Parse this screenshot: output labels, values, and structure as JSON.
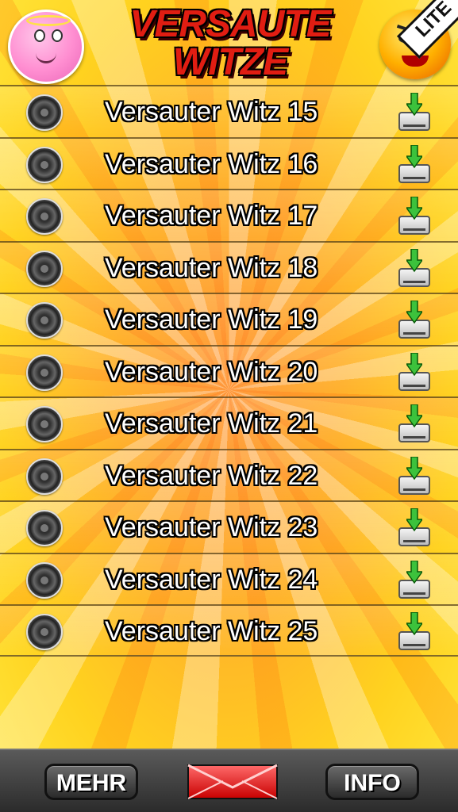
{
  "header": {
    "logo_line1": "VERSAUTE",
    "logo_line2": "WITZE",
    "lite_badge": "LITE",
    "left_icon": "angel-smiley-icon",
    "right_icon": "devil-smiley-icon"
  },
  "list": {
    "items": [
      {
        "label": "Versauter Witz 15"
      },
      {
        "label": "Versauter Witz 16"
      },
      {
        "label": "Versauter Witz 17"
      },
      {
        "label": "Versauter Witz 18"
      },
      {
        "label": "Versauter Witz 19"
      },
      {
        "label": "Versauter Witz 20"
      },
      {
        "label": "Versauter Witz 21"
      },
      {
        "label": "Versauter Witz 22"
      },
      {
        "label": "Versauter Witz 23"
      },
      {
        "label": "Versauter Witz 24"
      },
      {
        "label": "Versauter Witz 25"
      }
    ],
    "play_icon": "speaker-icon",
    "download_icon": "download-drive-icon"
  },
  "toolbar": {
    "mehr_label": "MEHR",
    "info_label": "INFO",
    "mail_icon": "mail-envelope-icon"
  },
  "colors": {
    "accent_red": "#e11d12",
    "background_yellow": "#ffd21f",
    "background_orange": "#ff9a3c",
    "toolbar_dark": "#2a2a2a"
  }
}
